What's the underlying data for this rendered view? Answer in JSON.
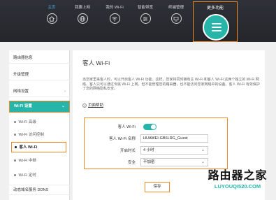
{
  "topnav": {
    "items": [
      {
        "label": "主页",
        "icon": "home-icon"
      },
      {
        "label": "我要上网",
        "icon": "globe-icon"
      },
      {
        "label": "我的 Wi-Fi",
        "icon": "wifi-icon"
      },
      {
        "label": "智能带宽",
        "icon": "bandwidth-icon"
      },
      {
        "label": "终端管理",
        "icon": "devices-icon"
      }
    ],
    "more_label": "更多功能",
    "active_color": "#4fb3e8"
  },
  "sidebar": {
    "items": [
      {
        "label": "路由器信息"
      },
      {
        "label": "升级管理"
      },
      {
        "label": "网络设置",
        "chevron": "›"
      },
      {
        "label": "Wi-Fi 设置",
        "chevron": "⌄"
      }
    ],
    "subitems": [
      {
        "label": "Wi-Fi 高级"
      },
      {
        "label": "Wi-Fi 访问控制"
      },
      {
        "label": "客人 Wi-Fi"
      },
      {
        "label": "Wi-Fi 中继"
      },
      {
        "label": "Wi-Fi 定时"
      }
    ],
    "bottom_item": "动态域名服务 DDNS"
  },
  "content": {
    "title": "客人 Wi-Fi",
    "description": "当您家里来客人时，可以开启客人 Wi-Fi 功能。这样，您家将同时拥有主 Wi-Fi 和客人 Wi-Fi 这两个独立的 Wi-Fi 网络。客人只可以通过专属 Wi-Fi 上网，但不能管理您的路由器，也不能访问您家网络中的设备。客人 Wi-Fi 有效保护了您的网络隐私安全。",
    "help_label": "页面帮助",
    "form": {
      "guest_wifi_label": "客人 Wi-Fi",
      "guest_wifi_enabled": true,
      "name_label": "客人 Wi-Fi 名称",
      "name_value": "HUAWEI-GB6LRG_Guest",
      "duration_label": "开启时长",
      "duration_value": "4 小时",
      "security_label": "安全",
      "security_value": "不加密"
    },
    "save_label": "保存"
  },
  "watermark": {
    "big": "路由器之家",
    "small": "LUYOUQI520.COM"
  },
  "colors": {
    "accent": "#27b5a9",
    "highlight": "#f08a24",
    "topbar": "#2a2c33"
  }
}
